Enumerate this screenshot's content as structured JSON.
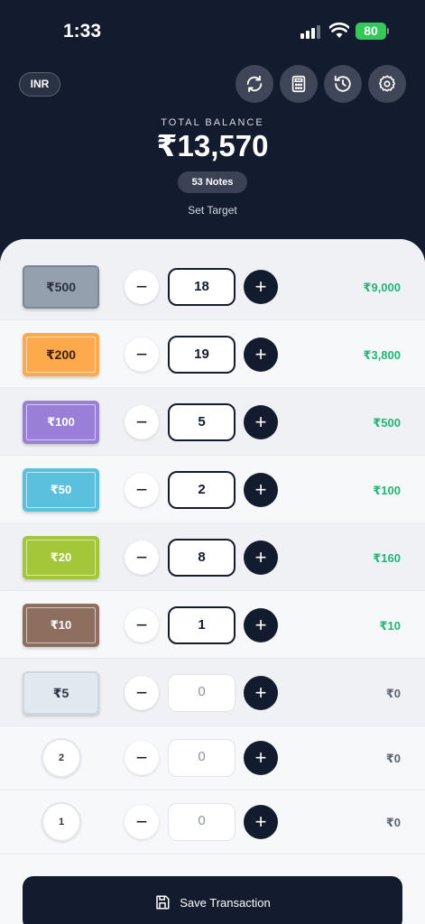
{
  "status": {
    "time": "1:33",
    "battery": "80"
  },
  "header": {
    "currency": "INR",
    "total_label": "TOTAL BALANCE",
    "total_value": "₹13,570",
    "notes_count": "53 Notes",
    "set_target": "Set Target",
    "icons": [
      "refresh-icon",
      "calculator-icon",
      "history-icon",
      "settings-icon"
    ]
  },
  "rows": [
    {
      "label": "₹500",
      "qty": "18",
      "amount": "₹9,000"
    },
    {
      "label": "₹200",
      "qty": "19",
      "amount": "₹3,800"
    },
    {
      "label": "₹100",
      "qty": "5",
      "amount": "₹500"
    },
    {
      "label": "₹50",
      "qty": "2",
      "amount": "₹100"
    },
    {
      "label": "₹20",
      "qty": "8",
      "amount": "₹160"
    },
    {
      "label": "₹10",
      "qty": "1",
      "amount": "₹10"
    },
    {
      "label": "₹5",
      "qty": "0",
      "amount": "₹0"
    },
    {
      "label": "2",
      "qty": "0",
      "amount": "₹0"
    },
    {
      "label": "1",
      "qty": "0",
      "amount": "₹0"
    }
  ],
  "controls": {
    "minus": "−",
    "plus": "+"
  },
  "save_label": "Save Transaction",
  "colors": {
    "primary": "#131b2e",
    "positive": "#22b574",
    "note_500": "#94a0ad",
    "note_200": "#ffa94d",
    "note_100": "#9a7fd8",
    "note_50": "#5bc0de",
    "note_20": "#a4c639",
    "note_10": "#8d6e5f",
    "note_5": "#e2e8f0"
  }
}
